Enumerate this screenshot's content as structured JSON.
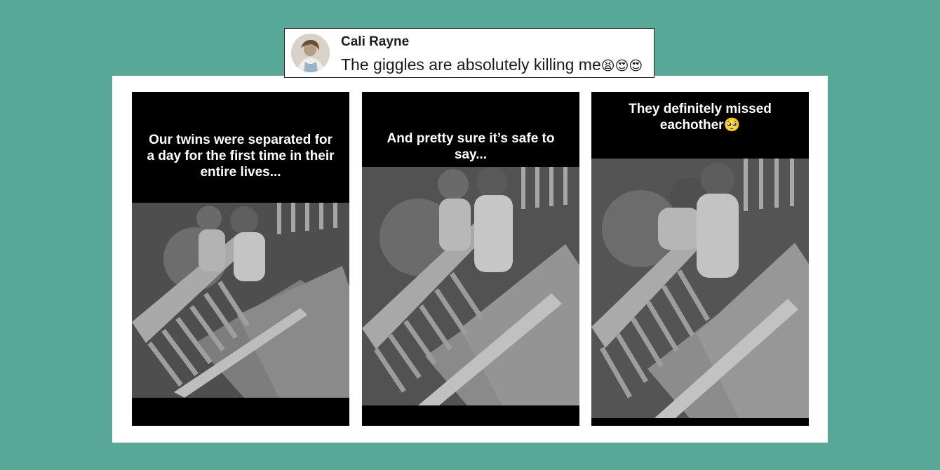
{
  "comment": {
    "author": "Cali Rayne",
    "text": "The giggles are absolutely killing me",
    "emojis": "😫😍😍",
    "avatar_icon": "user-avatar-photo"
  },
  "panels": [
    {
      "caption": "Our twins were separated for a day for the first time in their entire lives...",
      "photo": "night-camera-crib-twins"
    },
    {
      "caption": "And pretty sure it’s safe to say...",
      "photo": "night-camera-crib-twins-hugging"
    },
    {
      "caption": "They definitely missed eachother",
      "caption_emoji": "🥺",
      "photo": "night-camera-crib-twins-embracing"
    }
  ],
  "colors": {
    "background": "#58a897",
    "frame": "#ffffff",
    "panel": "#000000"
  }
}
